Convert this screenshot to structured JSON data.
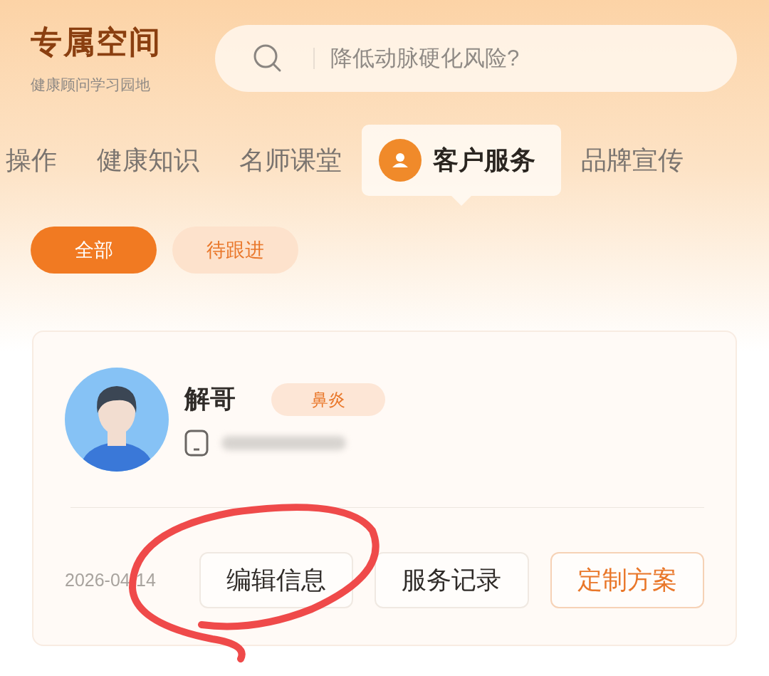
{
  "header": {
    "title": "专属空间",
    "subtitle": "健康顾问学习园地"
  },
  "search": {
    "placeholder": "降低动脉硬化风险?"
  },
  "tabs": [
    {
      "label": "操作",
      "selected": false
    },
    {
      "label": "健康知识",
      "selected": false
    },
    {
      "label": "名师课堂",
      "selected": false
    },
    {
      "label": "客户服务",
      "selected": true
    },
    {
      "label": "品牌宣传",
      "selected": false
    }
  ],
  "filters": [
    {
      "label": "全部",
      "selected": true
    },
    {
      "label": "待跟进",
      "selected": false
    }
  ],
  "customer": {
    "name": "解哥",
    "tag": "鼻炎",
    "date": "2026-04-14",
    "actions": [
      {
        "label": "编辑信息",
        "kind": "plain"
      },
      {
        "label": "服务记录",
        "kind": "plain"
      },
      {
        "label": "定制方案",
        "kind": "primary"
      }
    ]
  }
}
